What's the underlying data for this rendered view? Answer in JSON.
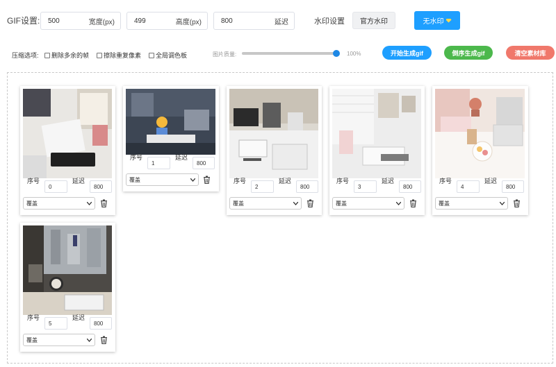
{
  "toolbar": {
    "gif_label": "GIF设置:",
    "width_value": "500",
    "width_suffix": "宽度(px)",
    "height_value": "499",
    "height_suffix": "高度(px)",
    "delay_value": "800",
    "delay_suffix": "延迟",
    "watermark_label": "水印设置",
    "official_watermark": "官方水印",
    "no_watermark": "无水印"
  },
  "options": {
    "compress_label": "压缩选项:",
    "checkboxes": [
      "删除多余的帧",
      "擦除重复像素",
      "全局调色板"
    ],
    "quality_label": "图片质量:",
    "quality_value": "100%",
    "quality_fraction": 1.0,
    "start_button": "开始生成gif",
    "reverse_button": "倒序生成gif",
    "clear_button": "清空素材库"
  },
  "card_labels": {
    "order": "序号",
    "delay": "延迟",
    "select_default": "覆盖"
  },
  "cards": [
    {
      "order": "0",
      "delay": "800",
      "select": "覆盖"
    },
    {
      "order": "1",
      "delay": "800",
      "select": "覆盖"
    },
    {
      "order": "2",
      "delay": "800",
      "select": "覆盖"
    },
    {
      "order": "3",
      "delay": "800",
      "select": "覆盖"
    },
    {
      "order": "4",
      "delay": "800",
      "select": "覆盖"
    },
    {
      "order": "5",
      "delay": "800",
      "select": "覆盖"
    }
  ],
  "colors": {
    "accent_blue": "#1e9fff",
    "green": "#4cb84c",
    "salmon": "#f0786b",
    "slider_blue": "#1e88e5"
  }
}
